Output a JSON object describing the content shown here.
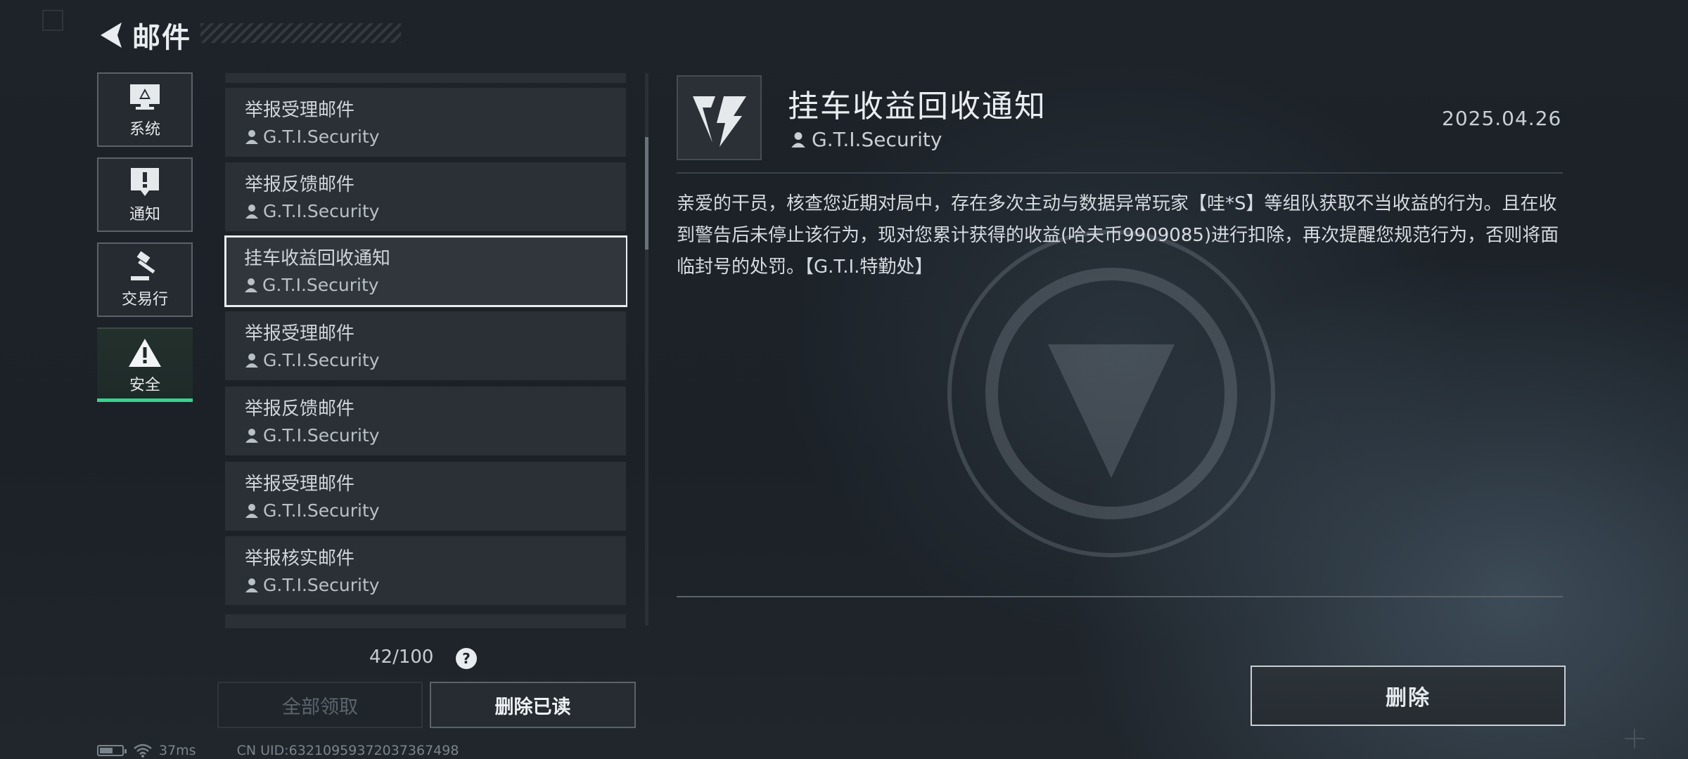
{
  "header": {
    "title": "邮件"
  },
  "categories": [
    {
      "label": "系统",
      "icon": "monitor-warning-icon",
      "active": false
    },
    {
      "label": "通知",
      "icon": "exclamation-box-icon",
      "active": false
    },
    {
      "label": "交易行",
      "icon": "gavel-icon",
      "active": false
    },
    {
      "label": "安全",
      "icon": "warning-triangle-icon",
      "active": true
    }
  ],
  "mail_list": {
    "items": [
      {
        "subject": "举报受理邮件",
        "sender": "G.T.I.Security"
      },
      {
        "subject": "举报反馈邮件",
        "sender": "G.T.I.Security"
      },
      {
        "subject": "挂车收益回收通知",
        "sender": "G.T.I.Security",
        "selected": true
      },
      {
        "subject": "举报受理邮件",
        "sender": "G.T.I.Security"
      },
      {
        "subject": "举报反馈邮件",
        "sender": "G.T.I.Security"
      },
      {
        "subject": "举报受理邮件",
        "sender": "G.T.I.Security"
      },
      {
        "subject": "举报核实邮件",
        "sender": "G.T.I.Security"
      }
    ],
    "count": "42/100",
    "help": "?",
    "claim_all_label": "全部领取",
    "delete_read_label": "删除已读"
  },
  "detail": {
    "title": "挂车收益回收通知",
    "sender": "G.T.I.Security",
    "date": "2025.04.26",
    "body": "亲爱的干员，核查您近期对局中，存在多次主动与数据异常玩家【哇*S】等组队获取不当收益的行为。且在收到警告后未停止该行为，现对您累计获得的收益(哈夫币9909085)进行扣除，再次提醒您规范行为，否则将面临封号的处罚。【G.T.I.特勤处】",
    "delete_label": "删除"
  },
  "status_bar": {
    "ping": "37ms",
    "uid": "CN UID:63210959372037367498"
  },
  "colors": {
    "accent": "#37d38e",
    "selected_border": "#e8ecef"
  }
}
